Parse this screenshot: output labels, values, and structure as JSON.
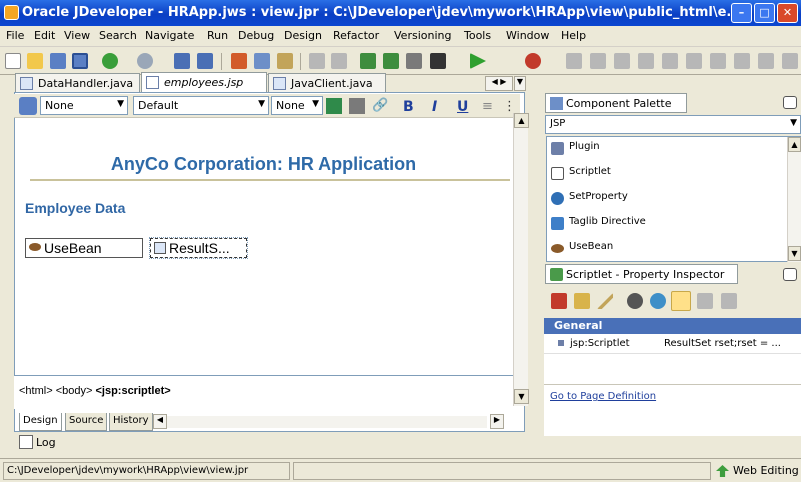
{
  "window": {
    "title": "Oracle JDeveloper - HRApp.jws : view.jpr : C:\\JDeveloper\\jdev\\mywork\\HRApp\\view\\public_html\\e...",
    "controls": [
      "minimize",
      "maximize",
      "close"
    ]
  },
  "menu": [
    "File",
    "Edit",
    "View",
    "Search",
    "Navigate",
    "Run",
    "Debug",
    "Design",
    "Refactor",
    "Versioning",
    "Tools",
    "Window",
    "Help"
  ],
  "toolbar_icons": [
    "new-icon",
    "open-icon",
    "save-icon",
    "save-all-icon",
    "back-icon",
    "forward-icon",
    "undo-icon",
    "redo-icon",
    "cut-icon",
    "copy-icon",
    "paste-icon",
    "make-icon",
    "rebuild-icon",
    "deploy-icon",
    "run-icon",
    "debug-icon",
    "profile-icon"
  ],
  "editor_tabs": [
    {
      "label": "DataHandler.java",
      "active": false
    },
    {
      "label": "employees.jsp",
      "active": true
    },
    {
      "label": "JavaClient.java",
      "active": false
    }
  ],
  "format_bar": {
    "style_select": "None",
    "font_select": "Default",
    "size_select": "None",
    "bold": "B",
    "italic": "I",
    "underline": "U"
  },
  "page": {
    "heading": "AnyCo Corporation: HR Application",
    "subheading": "Employee Data",
    "beans": [
      "UseBean",
      "ResultS..."
    ]
  },
  "tag_path": {
    "html": "<html>",
    "body": "<body>",
    "current": "<jsp:scriptlet>"
  },
  "bottom_tabs": [
    "Design",
    "Source",
    "History"
  ],
  "log_label": "Log",
  "component_palette": {
    "title": "Component Palette",
    "category": "JSP",
    "items": [
      "Plugin",
      "Scriptlet",
      "SetProperty",
      "Taglib Directive",
      "UseBean"
    ]
  },
  "property_inspector": {
    "title": "Scriptlet - Property Inspector",
    "section": "General",
    "rows": [
      {
        "name": "jsp:Scriptlet",
        "value": "ResultSet rset;rset = ..."
      }
    ],
    "link": "Go to Page Definition"
  },
  "statusbar": {
    "path": "C:\\JDeveloper\\jdev\\mywork\\HRApp\\view\\view.jpr",
    "mode": "Web Editing"
  },
  "colors": {
    "titlebar": "#0a3fc4",
    "heading": "#2e6aa8",
    "selection": "#4970b8",
    "link": "#1f3f9c"
  }
}
